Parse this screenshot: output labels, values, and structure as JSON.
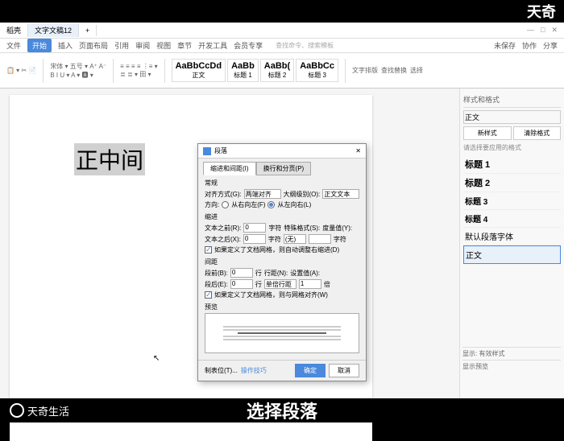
{
  "brand_top": "天奇",
  "titlebar": {
    "app": "稻壳",
    "doc": "文字文稿12"
  },
  "menu": {
    "items": [
      "文件",
      "开始",
      "插入",
      "页面布局",
      "引用",
      "审阅",
      "视图",
      "章节",
      "开发工具",
      "会员专享"
    ],
    "search": "查找命令、搜索模板",
    "right": [
      "未保存",
      "协作",
      "分享"
    ]
  },
  "ribbon": {
    "styles": [
      {
        "big": "AaBbCcDd",
        "label": "正文"
      },
      {
        "big": "AaBb",
        "label": "标题 1"
      },
      {
        "big": "AaBb(",
        "label": "标题 2"
      },
      {
        "big": "AaBbCc",
        "label": "标题 3"
      }
    ],
    "actions": [
      "文字排版",
      "查找替换",
      "选择"
    ]
  },
  "doc_text": "正中间",
  "side": {
    "title": "样式和格式",
    "current": "正文",
    "btn_new": "新样式",
    "btn_clear": "清除格式",
    "hint": "请选择要应用的格式",
    "styles": [
      "标题 1",
      "标题 2",
      "标题 3",
      "标题 4",
      "默认段落字体",
      "正文"
    ],
    "footer1": "显示: 有效样式",
    "footer2": "显示预览"
  },
  "dialog": {
    "title": "段落",
    "tab1": "缩进和间距(I)",
    "tab2": "换行和分页(P)",
    "sec_general": "常规",
    "align_label": "对齐方式(G):",
    "align_value": "两端对齐",
    "outline_label": "大纲级别(O):",
    "outline_value": "正文文本",
    "dir_label": "方向:",
    "dir_rtl": "从右向左(F)",
    "dir_ltr": "从左向右(L)",
    "sec_indent": "缩进",
    "before_text": "文本之前(R):",
    "after_text": "文本之后(X):",
    "unit_char": "字符",
    "special": "特殊格式(S):",
    "by": "度量值(Y):",
    "special_none": "(无)",
    "auto_indent": "如果定义了文档网格，则自动调整右缩进(D)",
    "sec_spacing": "间距",
    "before_para": "段前(B):",
    "after_para": "段后(E):",
    "unit_line": "行",
    "line_spacing": "行距(N):",
    "at": "设置值(A):",
    "line_value": "单倍行距",
    "at_unit": "倍",
    "same_style": "如果定义了文档网格，则与网格对齐(W)",
    "sec_preview": "预览",
    "tabs_btn": "制表位(T)...",
    "ops": "操作技巧",
    "ok": "确定",
    "cancel": "取消",
    "val_0": "0",
    "val_1": "1"
  },
  "bottom": {
    "logo": "天奇生活",
    "caption": "选择段落"
  }
}
